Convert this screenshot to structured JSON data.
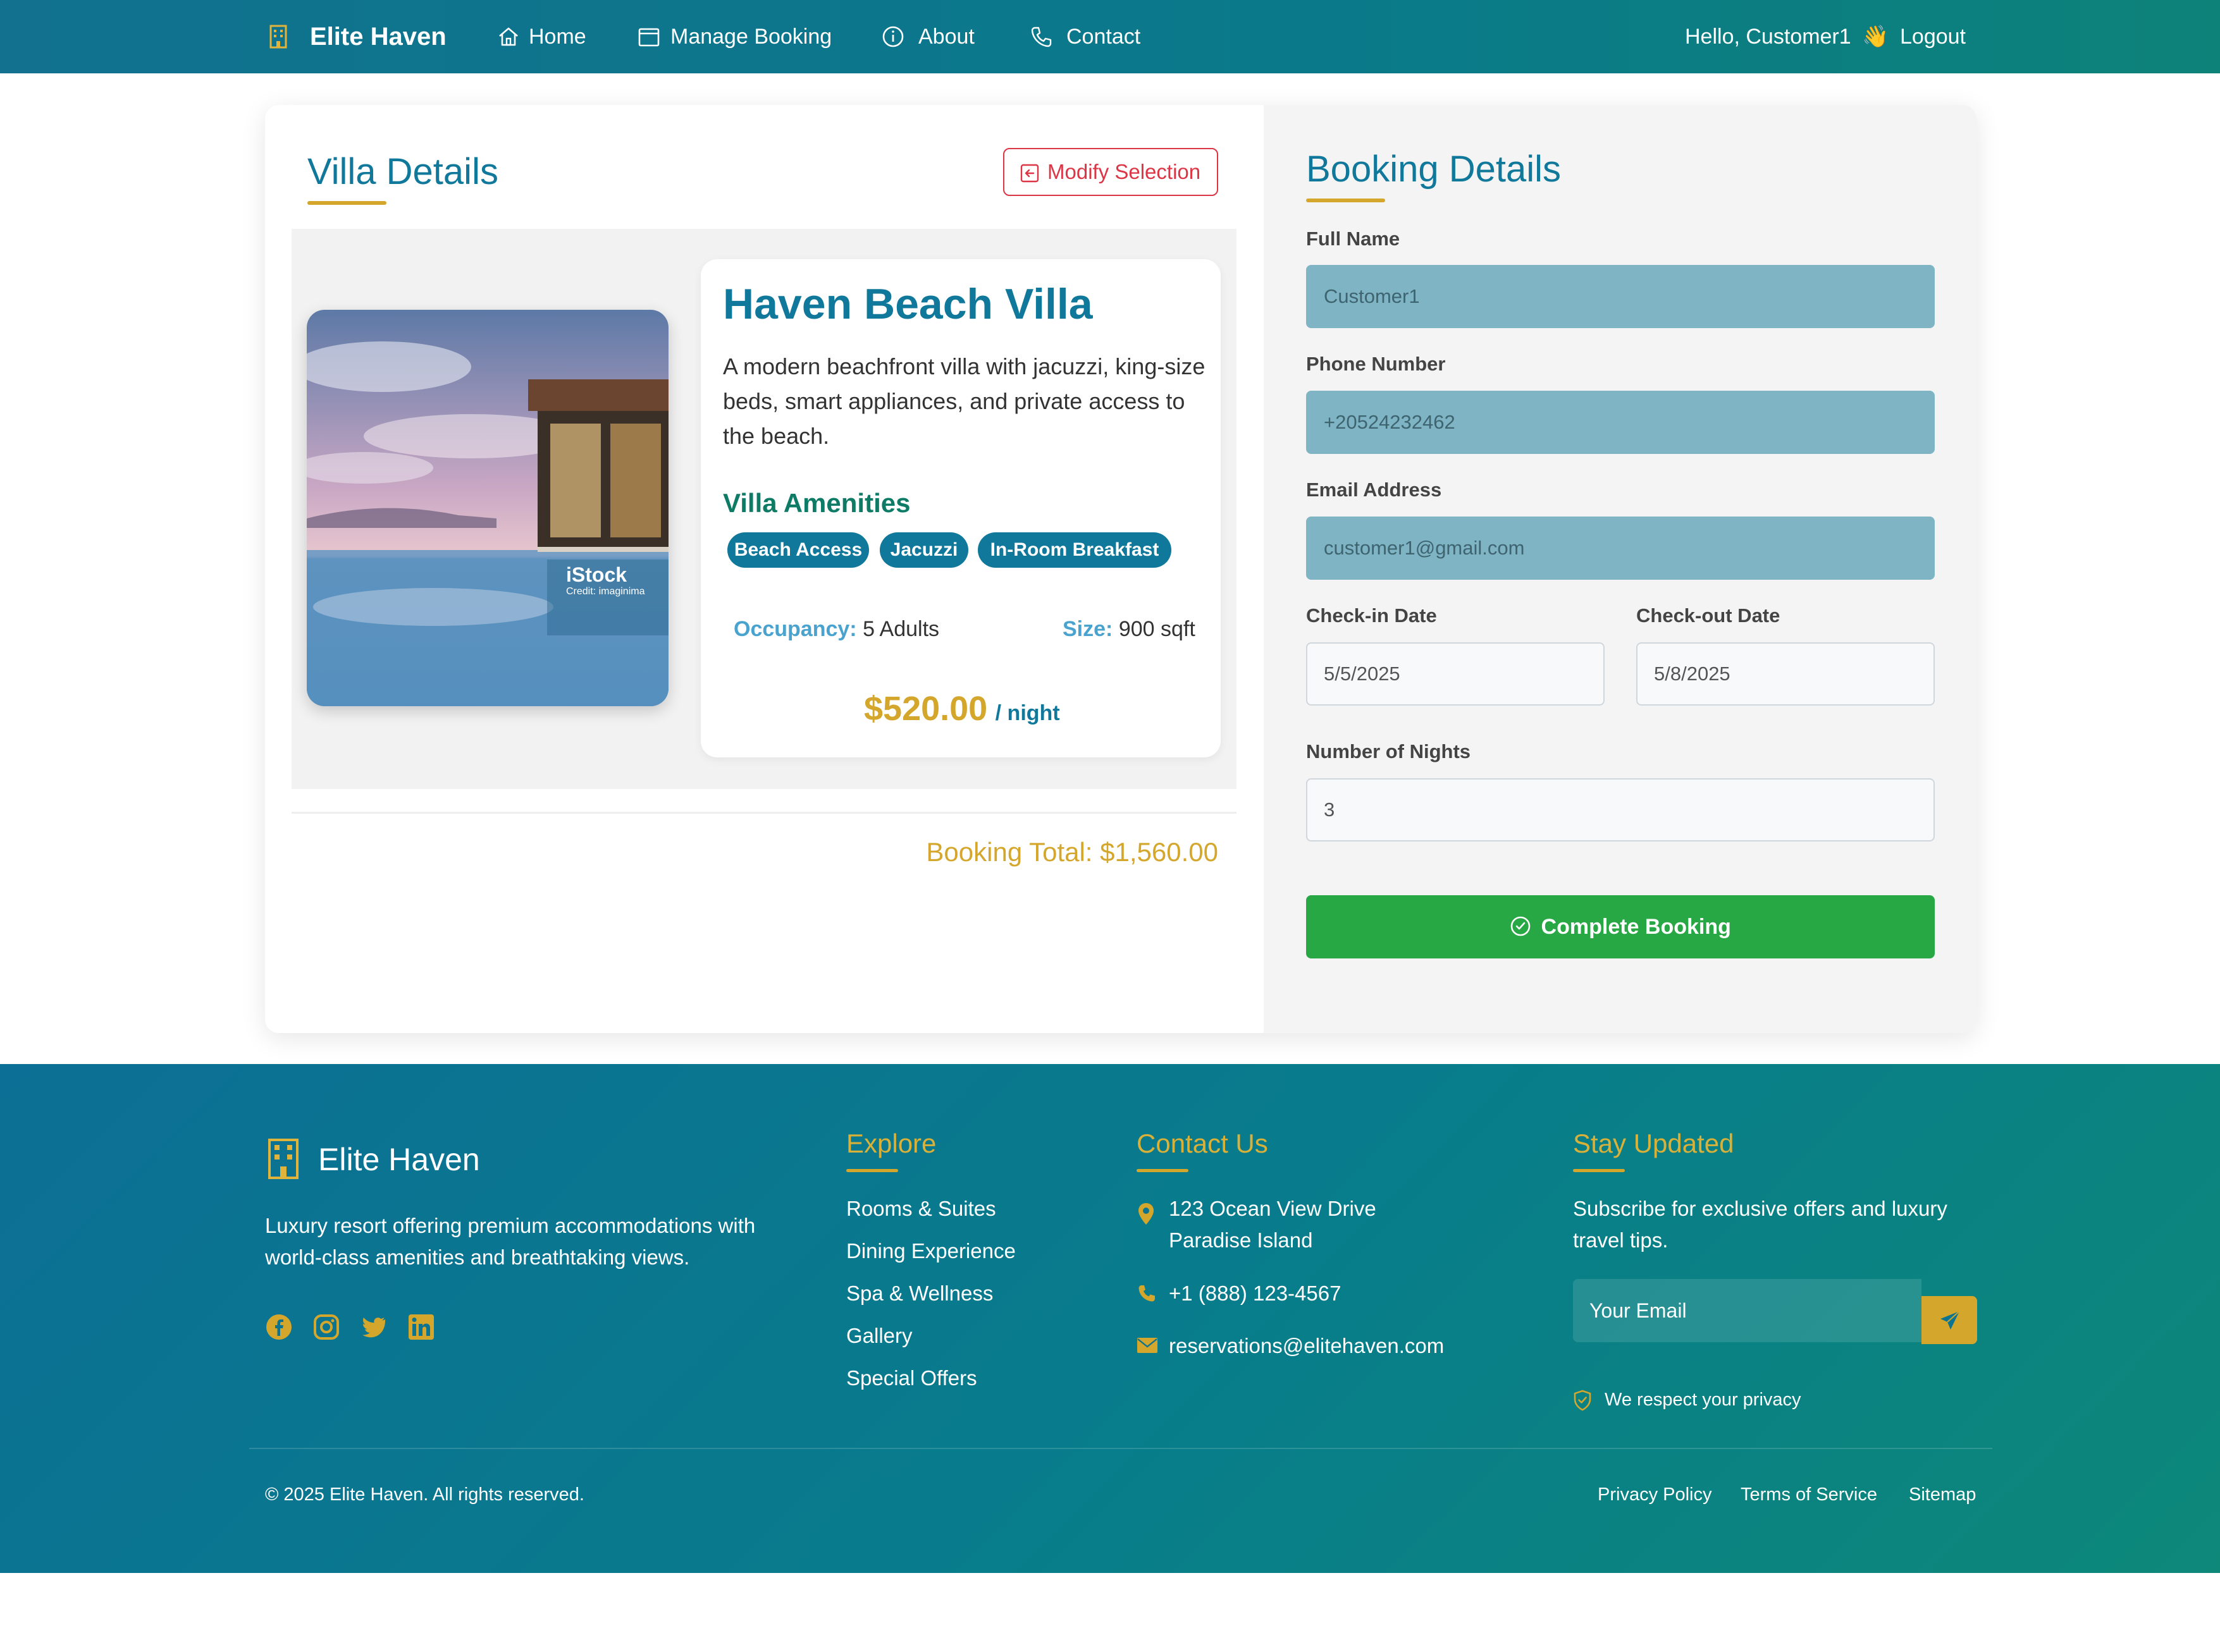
{
  "navbar": {
    "brand": "Elite Haven",
    "links": [
      {
        "label": "Home",
        "icon": "home-icon"
      },
      {
        "label": "Manage Booking",
        "icon": "calendar-icon"
      },
      {
        "label": "About",
        "icon": "info-icon"
      },
      {
        "label": "Contact",
        "icon": "phone-icon"
      }
    ],
    "greeting": "Hello, Customer1",
    "greeting_emoji": "👋",
    "logout_label": "Logout"
  },
  "villa": {
    "section_title": "Villa Details",
    "modify_label": "Modify Selection",
    "image_watermark": "iStock",
    "image_credit": "Credit: imaginima",
    "name": "Haven Beach Villa",
    "description": "A modern beachfront villa with jacuzzi, king-size beds, smart appliances, and private access to the beach.",
    "amenities_title": "Villa Amenities",
    "amenities": [
      "Beach Access",
      "Jacuzzi",
      "In-Room Breakfast"
    ],
    "occupancy_label": "Occupancy:",
    "occupancy_value": "5 Adults",
    "size_label": "Size:",
    "size_value": "900 sqft",
    "price": "$520.00",
    "price_unit": "/ night",
    "booking_total": "Booking Total: $1,560.00"
  },
  "booking": {
    "title": "Booking Details",
    "full_name_label": "Full Name",
    "full_name_value": "Customer1",
    "phone_label": "Phone Number",
    "phone_value": "+20524232462",
    "email_label": "Email Address",
    "email_value": "customer1@gmail.com",
    "checkin_label": "Check-in Date",
    "checkin_value": "5/5/2025",
    "checkout_label": "Check-out Date",
    "checkout_value": "5/8/2025",
    "nights_label": "Number of Nights",
    "nights_value": "3",
    "submit_label": "Complete Booking"
  },
  "footer": {
    "brand": "Elite Haven",
    "tagline_line1": "Luxury resort offering premium accommodations with",
    "tagline_line2": "world-class amenities and breathtaking views.",
    "social_icons": [
      "facebook-icon",
      "instagram-icon",
      "twitter-icon",
      "linkedin-icon"
    ],
    "explore_title": "Explore",
    "explore_links": [
      "Rooms & Suites",
      "Dining Experience",
      "Spa & Wellness",
      "Gallery",
      "Special Offers"
    ],
    "contact_title": "Contact Us",
    "address_line1": "123 Ocean View Drive",
    "address_line2": "Paradise Island",
    "phone": "+1 (888) 123-4567",
    "email": "reservations@elitehaven.com",
    "newsletter_title": "Stay Updated",
    "newsletter_line1": "Subscribe for exclusive offers and luxury",
    "newsletter_line2": "travel tips.",
    "email_placeholder": "Your Email",
    "privacy_note": "We respect your privacy",
    "copyright": "© 2025 Elite Haven. All rights reserved.",
    "legal_links": [
      "Privacy Policy",
      "Terms of Service",
      "Sitemap"
    ]
  },
  "colors": {
    "primary": "#10789a",
    "accent_gold": "#d4a72c",
    "success": "#28a745",
    "danger": "#dc3545",
    "amenity_green": "#0e7b67"
  }
}
